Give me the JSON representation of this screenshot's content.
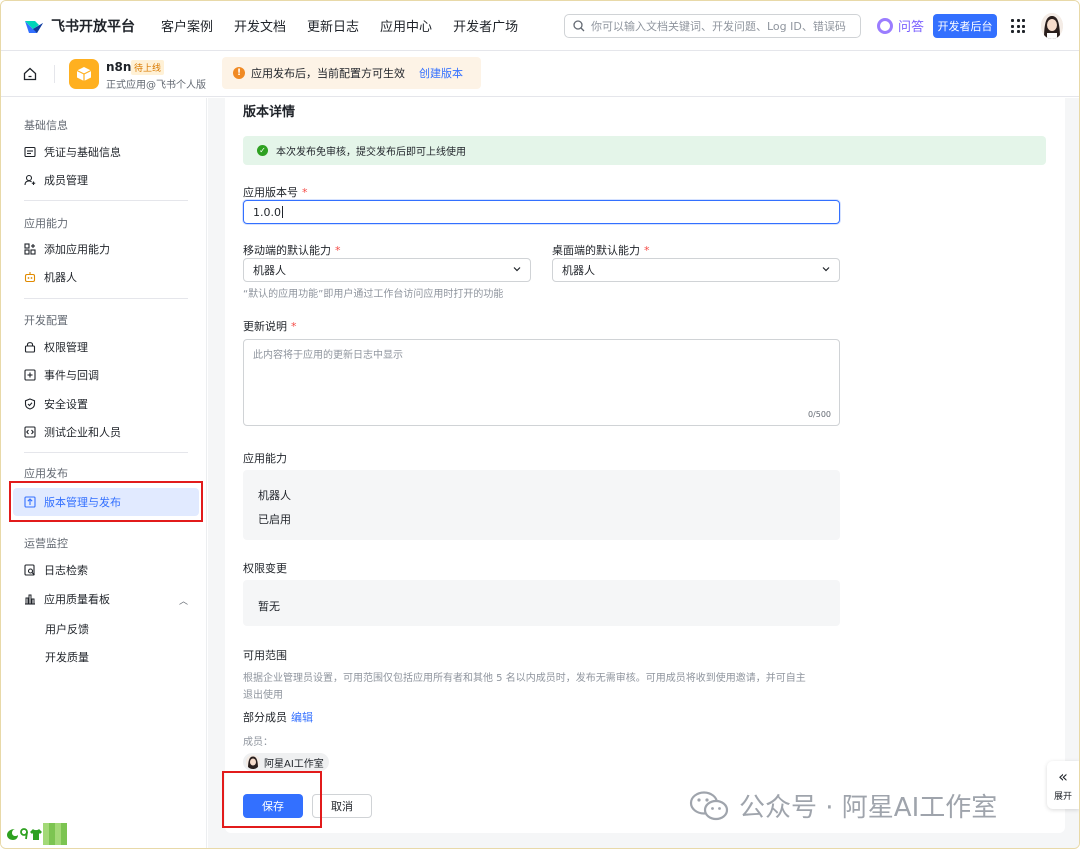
{
  "topnav": {
    "logo_text": "飞书开放平台",
    "links": [
      "客户案例",
      "开发文档",
      "更新日志",
      "应用中心",
      "开发者广场"
    ],
    "search_placeholder": "你可以输入文档关键词、开发问题、Log ID、错误码",
    "ask_label": "问答",
    "dev_console_label": "开发者后台"
  },
  "appbar": {
    "app_name": "n8n",
    "app_status": "待上线",
    "app_sub": "正式应用@飞书个人版",
    "notice_text": "应用发布后，当前配置方可生效",
    "notice_link": "创建版本"
  },
  "sidebar": {
    "groups": [
      "基础信息",
      "应用能力",
      "开发配置",
      "应用发布",
      "运营监控"
    ],
    "items": {
      "credentials": "凭证与基础信息",
      "members": "成员管理",
      "add_capability": "添加应用能力",
      "bot": "机器人",
      "permissions": "权限管理",
      "events": "事件与回调",
      "security": "安全设置",
      "test_enterprise": "测试企业和人员",
      "version_release": "版本管理与发布",
      "log_search": "日志检索",
      "quality_board": "应用质量看板",
      "user_feedback": "用户反馈",
      "dev_quality": "开发质量"
    }
  },
  "main": {
    "section_title": "版本详情",
    "success_text": "本次发布免审核，提交发布后即可上线使用",
    "version_label": "应用版本号",
    "version_value": "1.0.0",
    "mobile_default_label": "移动端的默认能力",
    "mobile_default_value": "机器人",
    "desktop_default_label": "桌面端的默认能力",
    "desktop_default_value": "机器人",
    "default_hint": "“默认的应用功能”即用户通过工作台访问应用时打开的功能",
    "update_notes_label": "更新说明",
    "update_notes_placeholder": "此内容将于应用的更新日志中显示",
    "update_notes_counter": "0/500",
    "capabilities_label": "应用能力",
    "capability_name": "机器人",
    "capability_status": "已启用",
    "permission_change_label": "权限变更",
    "permission_change_value": "暂无",
    "scope_label": "可用范围",
    "scope_hint_line1": "根据企业管理员设置，可用范围仅包括应用所有者和其他 5 名以内成员时，发布无需审核。可用成员将收到使用邀请，并可自主",
    "scope_hint_line2": "退出使用",
    "scope_mode": "部分成员",
    "scope_edit": "编辑",
    "members_label": "成员：",
    "member_name": "阿星AI工作室",
    "save_label": "保存",
    "cancel_label": "取消"
  },
  "expand_label": "展开",
  "watermark_text": "公众号 · 阿星AI工作室",
  "colors": {
    "accent": "#3370ff",
    "highlight_box": "#e21b1b",
    "success_bg": "#e4f5e9"
  }
}
